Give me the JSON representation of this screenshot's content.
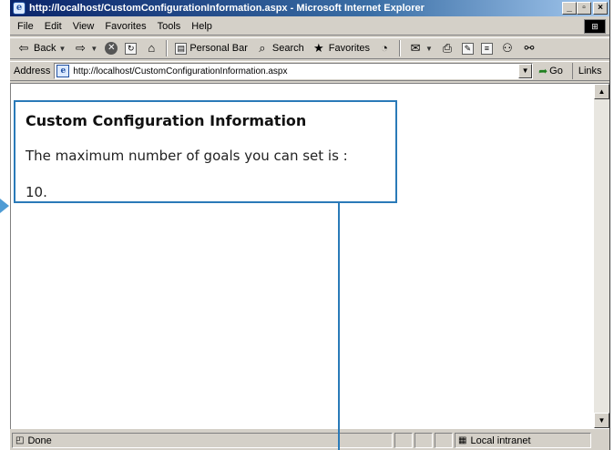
{
  "window": {
    "title": "http://localhost/CustomConfigurationInformation.aspx - Microsoft Internet Explorer",
    "buttons": {
      "minimize": "_",
      "maximize": "▫",
      "close": "×"
    }
  },
  "menu": [
    "File",
    "Edit",
    "View",
    "Favorites",
    "Tools",
    "Help"
  ],
  "toolbar": {
    "back": "Back",
    "personal_bar": "Personal Bar",
    "search": "Search",
    "favorites": "Favorites"
  },
  "address": {
    "label": "Address",
    "url": "http://localhost/CustomConfigurationInformation.aspx",
    "go": "Go",
    "links": "Links"
  },
  "page": {
    "heading": "Custom Configuration Information",
    "text": "The maximum number of goals you can set is :",
    "value": "10."
  },
  "status": {
    "text": "Done",
    "zone": "Local intranet"
  },
  "colors": {
    "callout": "#2a7ab8",
    "titlebar_start": "#0a246a",
    "chrome": "#d4d0c8"
  }
}
